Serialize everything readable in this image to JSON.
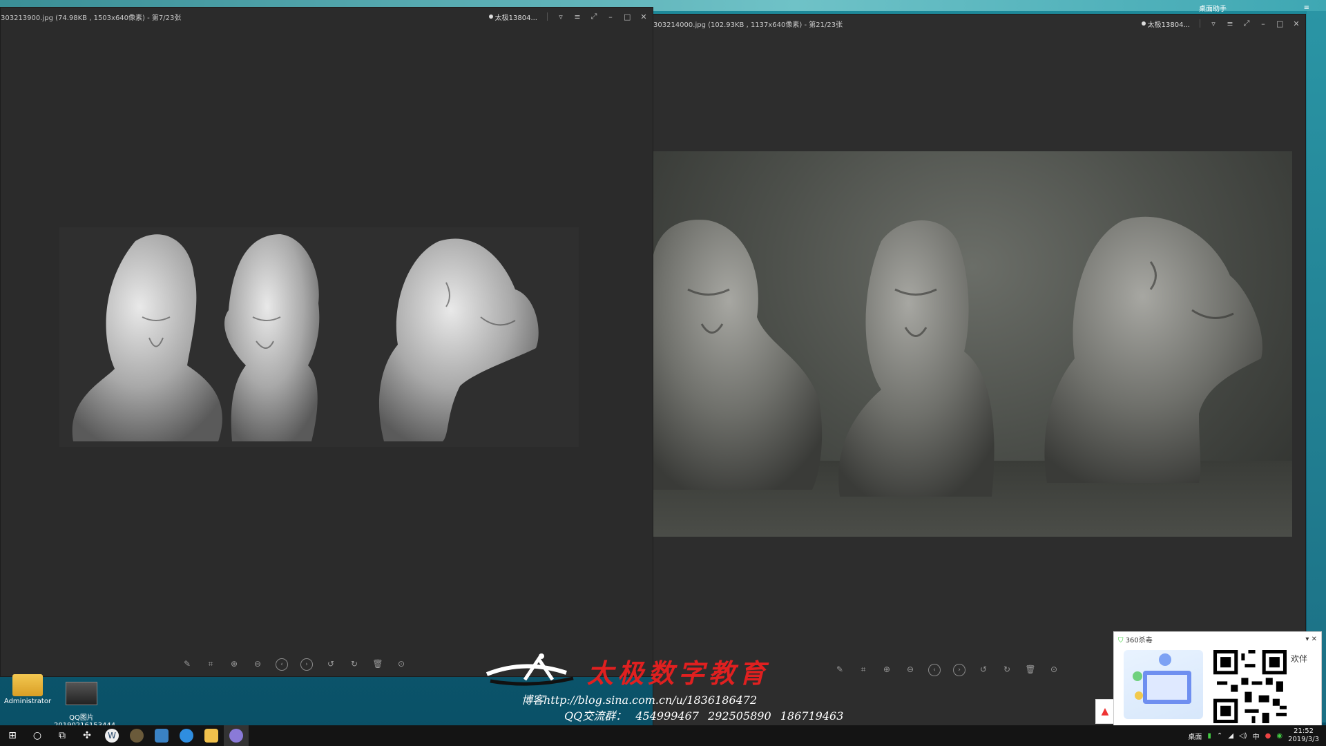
{
  "desktop": {
    "helper_title": "桌面助手"
  },
  "left_viewer": {
    "title": "303213900.jpg (74.98KB , 1503x640像素) - 第7/23张",
    "user": "太极13804..."
  },
  "right_viewer": {
    "title": "303214000.jpg (102.93KB , 1137x640像素) - 第21/23张",
    "user": "太极13804..."
  },
  "toolbar_icons": [
    "edit-icon",
    "crop-icon",
    "zoom-in-icon",
    "zoom-out-icon",
    "prev-icon",
    "next-icon",
    "rotate-left-icon",
    "rotate-right-icon",
    "delete-icon",
    "more-icon"
  ],
  "desktop_icons": [
    {
      "label": "Administrator"
    },
    {
      "label": "QQ图片\n20190216153444"
    }
  ],
  "watermark": {
    "brand": "太极数字教育",
    "blog": "博客http://blog.sina.com.cn/u/1836186472",
    "qq_label": "QQ交流群：",
    "qq_groups": "454999467   292505890   186719463"
  },
  "popup": {
    "title": "360杀毒",
    "side_text": "欢伴"
  },
  "taskbar": {
    "tray_desktop": "桌面",
    "ime": "中",
    "time": "21:52",
    "date": "2019/3/3"
  },
  "colors": {
    "viewer_bg": "#2b2b2b",
    "watermark_red": "#e02020",
    "taskbar": "#141414"
  }
}
